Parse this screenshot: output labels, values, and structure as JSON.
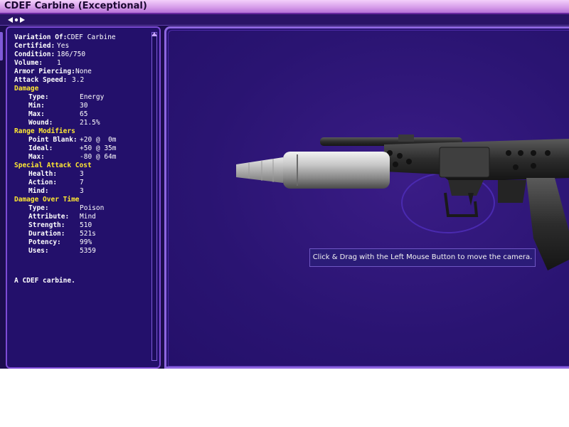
{
  "window": {
    "title": "CDEF Carbine (Exceptional)"
  },
  "stats": {
    "variation_of": {
      "label": "Variation Of:",
      "value": "CDEF Carbine"
    },
    "certified": {
      "label": "Certified:",
      "value": "Yes"
    },
    "condition": {
      "label": "Condition:",
      "value": "186/750"
    },
    "volume": {
      "label": "Volume:",
      "value": "1"
    },
    "armor_piercing": {
      "label": "Armor Piercing:",
      "value": "None"
    },
    "attack_speed": {
      "label": "Attack Speed:",
      "value": "3.2"
    },
    "damage": {
      "header": "Damage",
      "type": {
        "label": "Type:",
        "value": "Energy"
      },
      "min": {
        "label": "Min:",
        "value": "30"
      },
      "max": {
        "label": "Max:",
        "value": "65"
      },
      "wound": {
        "label": "Wound:",
        "value": "21.5%"
      }
    },
    "range_modifiers": {
      "header": "Range Modifiers",
      "point_blank": {
        "label": "Point Blank:",
        "value": "+20 @  0m"
      },
      "ideal": {
        "label": "Ideal:",
        "value": "+50 @ 35m"
      },
      "max": {
        "label": "Max:",
        "value": "-80 @ 64m"
      }
    },
    "special_attack_cost": {
      "header": "Special Attack Cost",
      "health": {
        "label": "Health:",
        "value": "3"
      },
      "action": {
        "label": "Action:",
        "value": "7"
      },
      "mind": {
        "label": "Mind:",
        "value": "3"
      }
    },
    "damage_over_time": {
      "header": "Damage Over Time",
      "type": {
        "label": "Type:",
        "value": "Poison"
      },
      "attribute": {
        "label": "Attribute:",
        "value": "Mind"
      },
      "strength": {
        "label": "Strength:",
        "value": "510"
      },
      "duration": {
        "label": "Duration:",
        "value": "521s"
      },
      "potency": {
        "label": "Potency:",
        "value": "99%"
      },
      "uses": {
        "label": "Uses:",
        "value": "5359"
      }
    },
    "description": "A CDEF carbine."
  },
  "viewer": {
    "tooltip": "Click & Drag with the Left Mouse Button to move the camera."
  },
  "colors": {
    "panel_bg": "#23106b",
    "viewer_bg": "#2a1472",
    "border_accent": "#8e66e0",
    "section_header": "#ffe833",
    "titlebar": "#d49ae8"
  },
  "icons": {
    "nav_arrows": "left-right-arrows-icon",
    "scroll_up": "scroll-up-arrow-icon",
    "weapon_model": "carbine-model"
  }
}
